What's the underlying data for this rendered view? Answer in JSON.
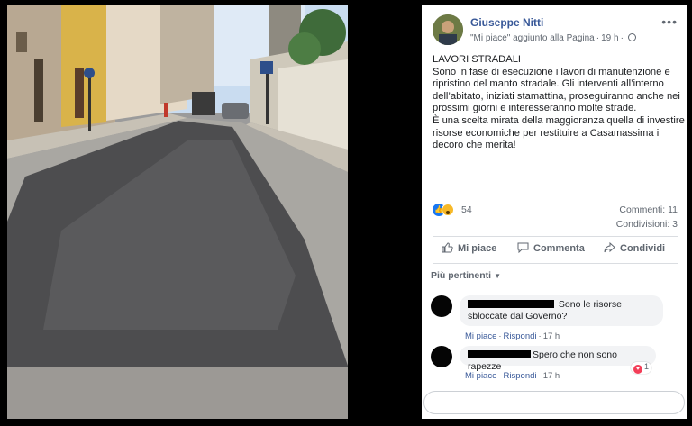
{
  "post": {
    "author": "Giuseppe Nitti",
    "activity": "\"Mi piace\" aggiunto alla Pagina",
    "separator": "·",
    "time": "19 h",
    "text": "LAVORI STRADALI\nSono in fase di esecuzione i lavori di manutenzione e ripristino del manto stradale. Gli interventi all’interno dell’abitato, iniziati stamattina, proseguiranno anche nei prossimi giorni e interesseranno molte strade.\nÈ una scelta mirata della maggioranza quella di investire risorse economiche per restituire a Casamassima il decoro che merita!",
    "reaction_count": "54",
    "comments_count": "Commenti: 11",
    "shares_count": "Condivisioni: 3",
    "reaction_icons": [
      "like-icon",
      "wow-icon"
    ]
  },
  "actions": {
    "like": "Mi piace",
    "comment": "Commenta",
    "share": "Condividi"
  },
  "comments_filter": "Più pertinenti",
  "comments": [
    {
      "text_line1": "Sono le risorse",
      "text_line2": "sbloccate dal Governo?",
      "like": "Mi piace",
      "reply": "Rispondi",
      "time": "17 h"
    },
    {
      "text": "Spero che non sono rapezze",
      "like": "Mi piace",
      "reply": "Rispondi",
      "time": "17 h",
      "reactions": "1"
    }
  ],
  "colors": {
    "link": "#385898",
    "like_blue": "#1877f2",
    "heart": "#f33e58",
    "background": "#000000"
  }
}
